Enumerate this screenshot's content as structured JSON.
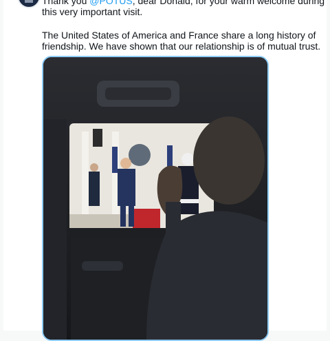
{
  "tweet": {
    "line1_prefix": "Thank you ",
    "mention": "@POTUS",
    "line1_suffix": ", dear Donald, for your warm welcome during this very important visit.",
    "paragraph2": "The United States of America and France share a long history of friendship. We have shown that our relationship is of mutual trust."
  },
  "media": {
    "kind": "photo"
  },
  "colors": {
    "mention": "#1d9bf0",
    "media_border": "#8ecdf8",
    "page_bg": "#f7f9f9"
  }
}
